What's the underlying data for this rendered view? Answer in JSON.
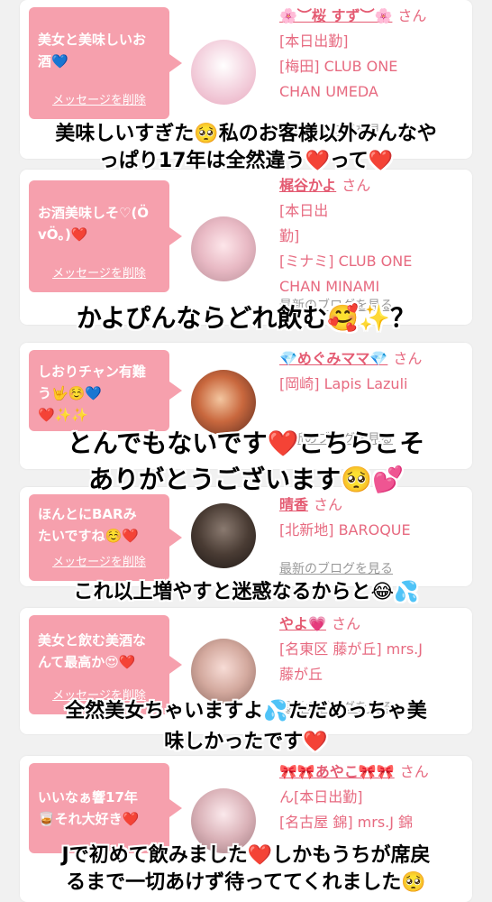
{
  "colors": {
    "bubble": "#f6a0ad",
    "accent": "#e76a80",
    "heart": "#d3141c"
  },
  "delete_label": "メッセージを削除",
  "blog_label": "最新のブログを見る",
  "san_label": "さん",
  "cards": [
    {
      "bubble": "美女と美味しいお\n酒💙",
      "name": "🌸︶桜 すず︶🌸",
      "info": "[本日出勤]\n[梅田] CLUB ONE\nCHAN UMEDA"
    },
    {
      "bubble": "お酒美味しそ♡(Ö\nvÖ｡)❤️",
      "name": "梶谷かよ",
      "info": "[本日出\n勤]\n[ミナミ] CLUB ONE\nCHAN MINAMI"
    },
    {
      "bubble": "しおりチャン有難\nう🤟☺️💙\n❤️✨✨",
      "name": "💎めぐみママ💎",
      "info": "[岡崎] Lapis Lazuli"
    },
    {
      "bubble": "ほんとにBARみ\nたいですね☺️❤️",
      "name": "晴香",
      "info": "[北新地] BAROQUE"
    },
    {
      "bubble": "美女と飲む美酒な\nんて最高か😍❤️",
      "name": "やよ💗",
      "info": "[名東区 藤が丘] mrs.J\n藤が丘"
    },
    {
      "bubble": "いいなぁ響17年\n🥃それ大好き❤️",
      "name": "🎀🎀あやこ🎀🎀",
      "info": "ん[本日出勤]\n[名古屋 錦] mrs.J 錦"
    }
  ],
  "overlays": [
    "美味しいすぎた🥺私のお客様以外みんなや\nっぱり17年は全然違う❤️って❤️",
    "かよぴんならどれ飲む🥰✨？",
    "とんでもないです❤️こちらこそ\nありがとうございます🥺💕",
    "これ以上増やすと迷惑なるからと😂💦",
    "全然美女ちゃいますよ💦ただめっちゃ美\n味しかったです❤️",
    "Jで初めて飲みました❤️しかもうちが席戻\nるまで一切あけず待っててくれました🥺"
  ]
}
